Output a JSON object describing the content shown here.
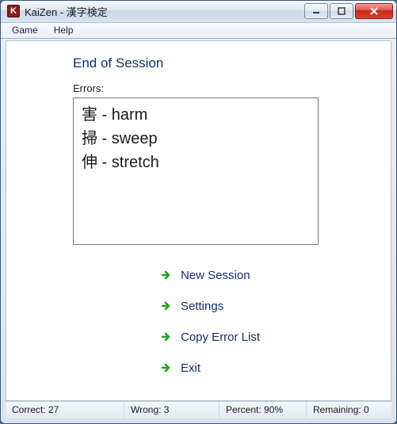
{
  "window": {
    "title": "KaiZen - 漢字検定",
    "icon_letter": "K"
  },
  "menu": {
    "game": "Game",
    "help": "Help"
  },
  "session": {
    "heading": "End of Session",
    "errors_label": "Errors:",
    "errors": [
      "害 - harm",
      "掃 - sweep",
      "伸 - stretch"
    ]
  },
  "actions": {
    "new_session": "New Session",
    "settings": "Settings",
    "copy_errors": "Copy Error List",
    "exit": "Exit"
  },
  "status": {
    "correct": "Correct: 27",
    "wrong": "Wrong: 3",
    "percent": "Percent: 90%",
    "remaining": "Remaining: 0"
  }
}
